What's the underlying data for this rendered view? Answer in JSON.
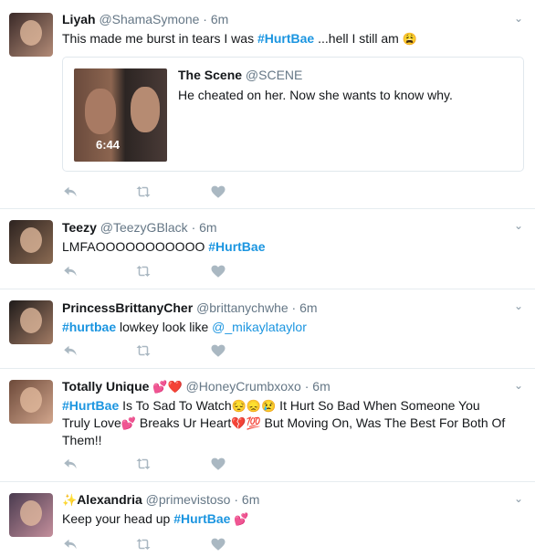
{
  "tweets": [
    {
      "name": "Liyah",
      "handle": "@ShamaSymone",
      "time": "6m",
      "text_parts": [
        "This made me burst in tears I was ",
        "#HurtBae",
        " ...hell I still am ",
        "😩"
      ],
      "card": {
        "name": "The Scene",
        "handle": "@SCENE",
        "text": "He cheated on her. Now she wants to know why.",
        "duration": "6:44"
      }
    },
    {
      "name": "Teezy",
      "handle": "@TeezyGBlack",
      "time": "6m",
      "text_parts": [
        "LMFAOOOOOOOOOOO ",
        "#HurtBae"
      ]
    },
    {
      "name": "PrincessBrittanyCher",
      "handle": "@brittanychwhe",
      "time": "6m",
      "text_parts": [
        "#hurtbae",
        " lowkey look like ",
        "@_mikaylataylor"
      ]
    },
    {
      "name": "Totally Unique",
      "name_emoji": "💕❤️",
      "handle": "@HoneyCrumbxoxo",
      "time": "6m",
      "line1_parts": [
        "#HurtBae",
        " Is To Sad To Watch",
        "😔😞😢",
        " It Hurt So Bad When Someone You"
      ],
      "line2_parts": [
        "Truly Love",
        "💕",
        " Breaks Ur Heart",
        "💔💯",
        " But Moving On, Was The Best For Both Of"
      ],
      "line3": "Them!!"
    },
    {
      "name_emoji": "✨",
      "name": "Alexandria",
      "handle": "@primevistoso",
      "time": "6m",
      "text_parts": [
        "Keep your head up ",
        "#HurtBae",
        " ",
        "💕"
      ]
    }
  ],
  "separator": "·",
  "icons": {
    "reply": "reply-icon",
    "retweet": "retweet-icon",
    "like": "heart-icon",
    "more": "chevron-down-icon"
  },
  "colors": {
    "link": "#1b95e0",
    "secondary_text": "#657786",
    "action_icon": "#aab8c2",
    "divider": "#e6ecf0"
  }
}
